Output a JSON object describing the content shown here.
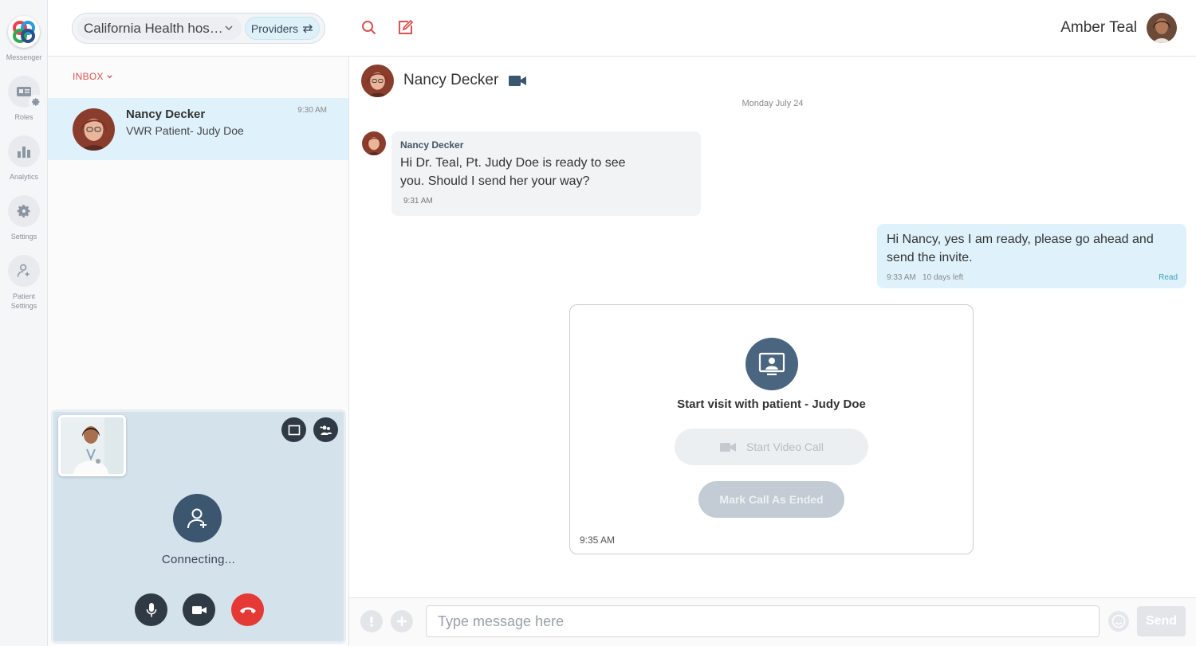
{
  "rail": {
    "messenger_label": "Messenger",
    "roles_label": "Roles",
    "analytics_label": "Analytics",
    "settings_label": "Settings",
    "patient_settings_label": "Patient Settings"
  },
  "header": {
    "org_name": "California Health hos…",
    "providers_label": "Providers",
    "user_name": "Amber Teal"
  },
  "inbox": {
    "header_label": "INBOX",
    "conversations": [
      {
        "name": "Nancy Decker",
        "preview": "VWR Patient- Judy Doe",
        "time": "9:30 AM"
      }
    ]
  },
  "call": {
    "status": "Connecting..."
  },
  "chat": {
    "contact_name": "Nancy Decker",
    "date_separator": "Monday July 24",
    "messages": [
      {
        "sender": "Nancy Decker",
        "text": "Hi Dr. Teal, Pt. Judy Doe is ready to see you.  Should I send her your way?",
        "time": "9:31 AM"
      },
      {
        "text": "Hi Nancy, yes I am ready, please go ahead and send the invite.",
        "time": "9:33 AM",
        "expiry": "10 days left",
        "status": "Read"
      }
    ],
    "visit_card": {
      "title": "Start visit with patient - Judy Doe",
      "start_video_label": "Start Video Call",
      "mark_ended_label": "Mark Call As Ended",
      "time": "9:35 AM"
    }
  },
  "compose": {
    "placeholder": "Type message here",
    "send_label": "Send"
  },
  "colors": {
    "accent_red": "#d9534f",
    "selected_row": "#dff2fb",
    "navy": "#3c5670",
    "hangup": "#e53935"
  }
}
